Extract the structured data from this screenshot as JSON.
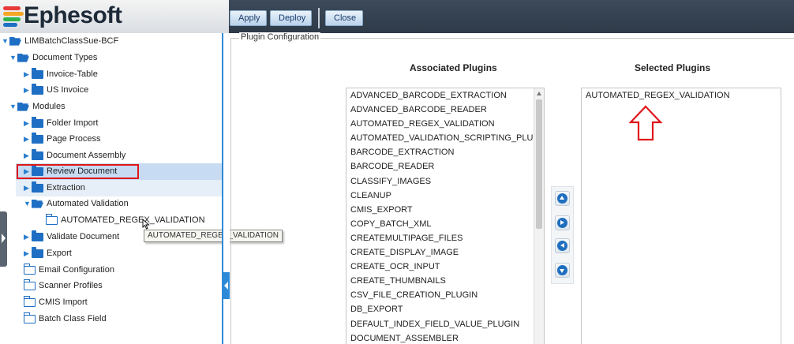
{
  "app": {
    "logo_text": "Ephesoft",
    "logo_colors": [
      "#e93a3a",
      "#f5a623",
      "#2fb34a",
      "#1e6fc4"
    ]
  },
  "toolbar": {
    "apply_label": "Apply",
    "deploy_label": "Deploy",
    "close_label": "Close"
  },
  "tree": {
    "root": "LIMBatchClassSue-BCF",
    "document_types": "Document Types",
    "invoice_table": "Invoice-Table",
    "us_invoice": "US Invoice",
    "modules": "Modules",
    "folder_import": "Folder Import",
    "page_process": "Page Process",
    "document_assembly": "Document Assembly",
    "review_document": "Review Document",
    "extraction": "Extraction",
    "automated_validation": "Automated Validation",
    "automated_regex_validation": "AUTOMATED_REGEX_VALIDATION",
    "validate_document": "Validate Document",
    "export": "Export",
    "email_configuration": "Email Configuration",
    "scanner_profiles": "Scanner Profiles",
    "cmis_import": "CMIS Import",
    "batch_class_field": "Batch Class Field",
    "tooltip": "AUTOMATED_REGEX_VALIDATION"
  },
  "plugin_config": {
    "legend": "Plugin Configuration",
    "associated_heading": "Associated Plugins",
    "selected_heading": "Selected Plugins",
    "associated": [
      "ADVANCED_BARCODE_EXTRACTION",
      "ADVANCED_BARCODE_READER",
      "AUTOMATED_REGEX_VALIDATION",
      "AUTOMATED_VALIDATION_SCRIPTING_PLUGIN",
      "BARCODE_EXTRACTION",
      "BARCODE_READER",
      "CLASSIFY_IMAGES",
      "CLEANUP",
      "CMIS_EXPORT",
      "COPY_BATCH_XML",
      "CREATEMULTIPAGE_FILES",
      "CREATE_DISPLAY_IMAGE",
      "CREATE_OCR_INPUT",
      "CREATE_THUMBNAILS",
      "CSV_FILE_CREATION_PLUGIN",
      "DB_EXPORT",
      "DEFAULT_INDEX_FIELD_VALUE_PLUGIN",
      "DOCUMENT_ASSEMBLER"
    ],
    "selected": [
      "AUTOMATED_REGEX_VALIDATION"
    ]
  }
}
